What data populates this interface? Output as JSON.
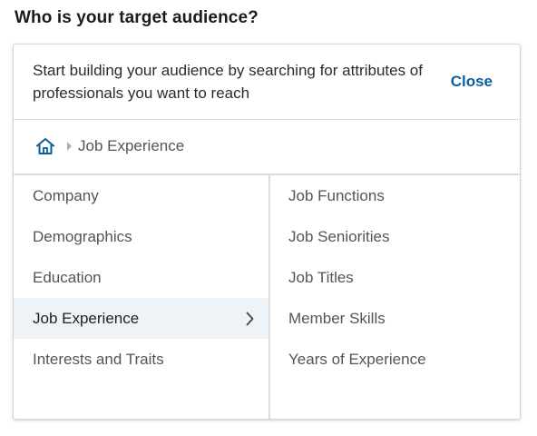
{
  "heading": "Who is your target audience?",
  "intro": {
    "text": "Start building your audience by searching for attributes of professionals you want to reach",
    "close_label": "Close"
  },
  "breadcrumb": {
    "home_icon": "home-icon",
    "current": "Job Experience"
  },
  "categories": [
    {
      "label": "Company"
    },
    {
      "label": "Demographics"
    },
    {
      "label": "Education"
    },
    {
      "label": "Job Experience",
      "active": true
    },
    {
      "label": "Interests and Traits"
    }
  ],
  "subcategories": [
    {
      "label": "Job Functions"
    },
    {
      "label": "Job Seniorities"
    },
    {
      "label": "Job Titles"
    },
    {
      "label": "Member Skills"
    },
    {
      "label": "Years of Experience"
    }
  ],
  "colors": {
    "accent": "#0b5f9e",
    "active_bg": "#eef3f8"
  }
}
